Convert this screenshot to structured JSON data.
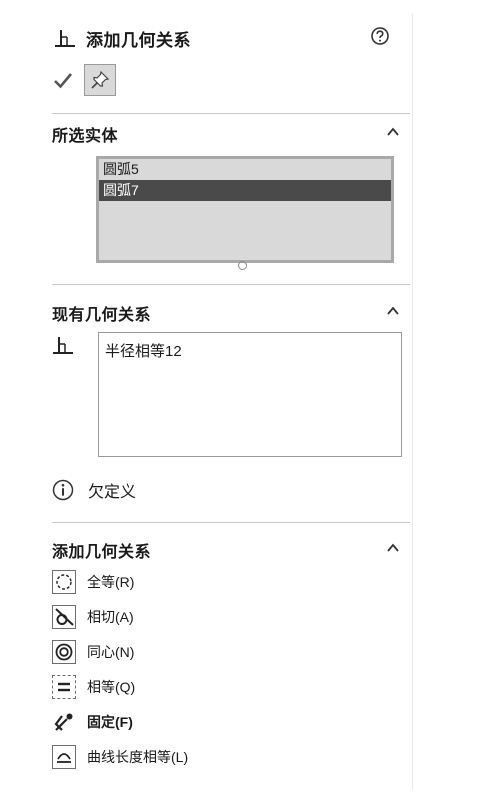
{
  "header": {
    "title": "添加几何关系",
    "help_icon": "question-circle-icon",
    "ok_icon": "checkmark-icon",
    "pin_icon": "pushpin-icon"
  },
  "selected_entities": {
    "title": "所选实体",
    "items": [
      {
        "label": "圆弧5",
        "selected": false
      },
      {
        "label": "圆弧7",
        "selected": true
      }
    ]
  },
  "existing_relations": {
    "title": "现有几何关系",
    "items": [
      {
        "label": "半径相等12",
        "icon": "equal-relation-icon"
      }
    ],
    "status_icon": "info-icon",
    "status": "欠定义"
  },
  "add_relations": {
    "title": "添加几何关系",
    "items": [
      {
        "label": "全等(R)",
        "icon": "coradial-icon",
        "bold": false
      },
      {
        "label": "相切(A)",
        "icon": "tangent-icon",
        "bold": false
      },
      {
        "label": "同心(N)",
        "icon": "concentric-icon",
        "bold": false
      },
      {
        "label": "相等(Q)",
        "icon": "equal-icon",
        "bold": false
      },
      {
        "label": "固定(F)",
        "icon": "fix-icon",
        "bold": true
      },
      {
        "label": "曲线长度相等(L)",
        "icon": "equal-curve-length-icon",
        "bold": false
      }
    ]
  },
  "colors": {
    "selection": "#4a4a4a",
    "list_background": "#d9d9d9",
    "divider": "#c8c8c8"
  }
}
